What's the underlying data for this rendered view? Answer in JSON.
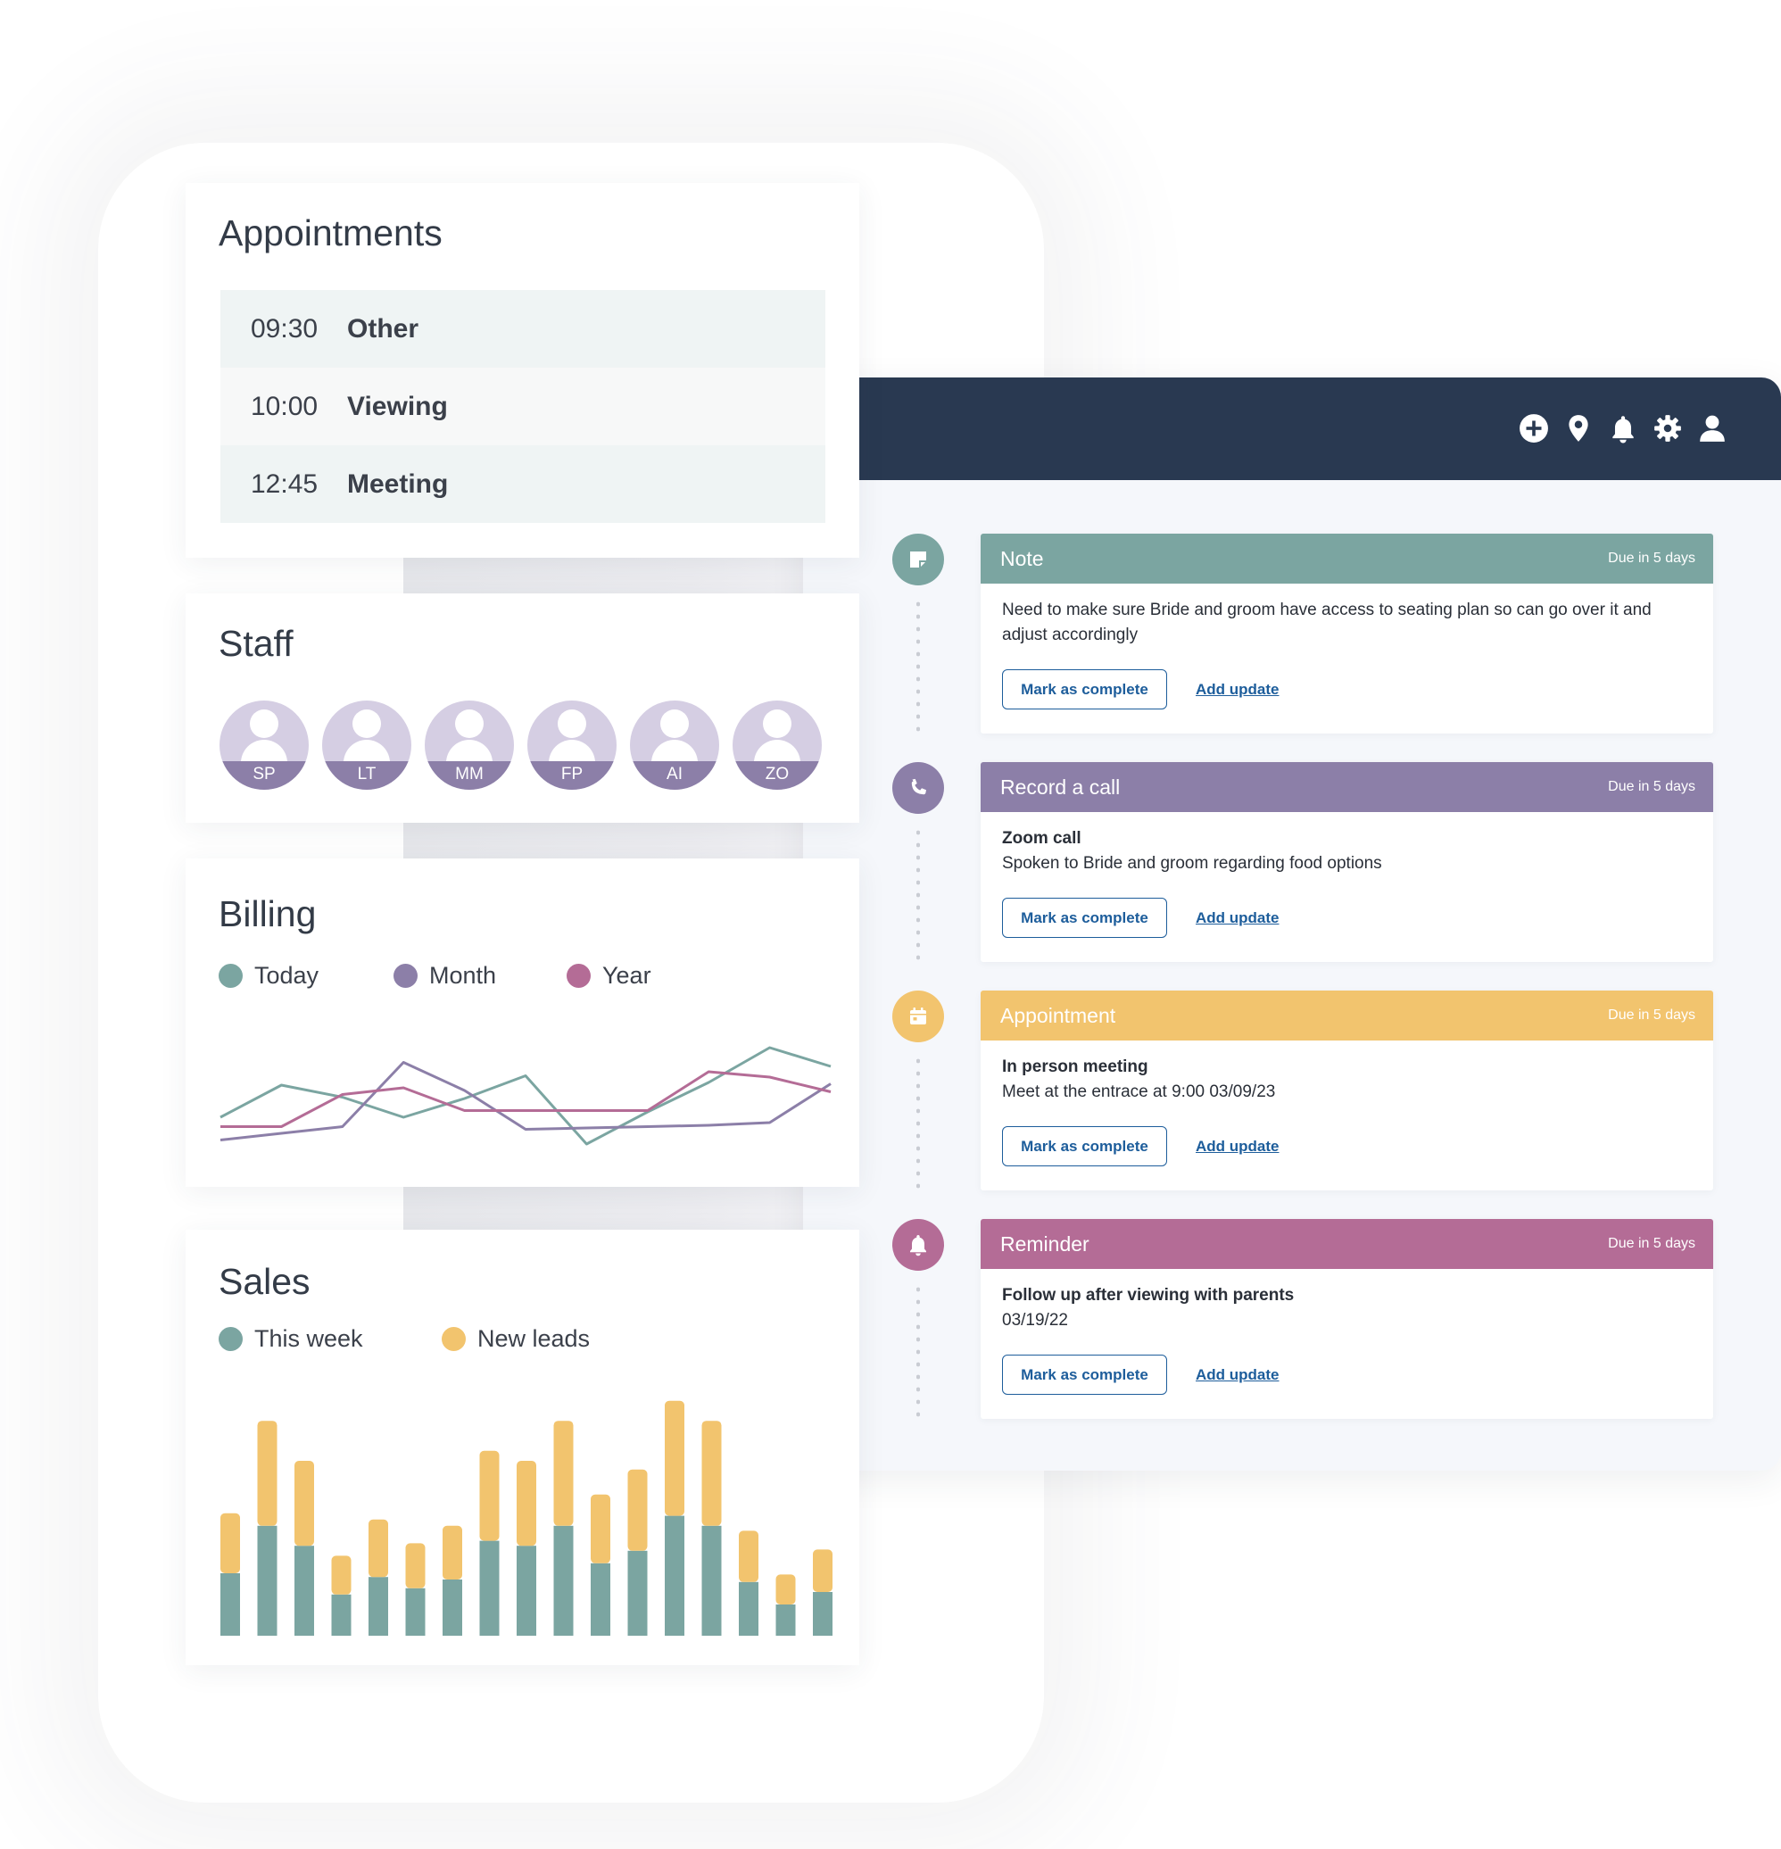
{
  "colors": {
    "teal": "#7ba5a1",
    "purple": "#8c7fa8",
    "yellow": "#f2c46e",
    "pink": "#b46c96",
    "navy": "#293951",
    "link_blue": "#1d5d9b"
  },
  "header": {
    "icons": [
      "add-circle-icon",
      "location-pin-icon",
      "bell-icon",
      "gear-icon",
      "user-icon"
    ]
  },
  "timeline": {
    "items": [
      {
        "type": "Note",
        "icon": "note-icon",
        "due": "Due in 5 days",
        "body_bold": "",
        "body": "Need to make sure Bride and groom have access to seating plan so can go over it and adjust accordingly",
        "complete_label": "Mark as complete",
        "update_label": "Add update"
      },
      {
        "type": "Record a call",
        "icon": "phone-icon",
        "due": "Due in 5 days",
        "body_bold": "Zoom call",
        "body": "Spoken to Bride and groom regarding food options",
        "complete_label": "Mark as complete",
        "update_label": "Add update"
      },
      {
        "type": "Appointment",
        "icon": "calendar-icon",
        "due": "Due in 5 days",
        "body_bold": "In person meeting",
        "body": "Meet at the entrace at 9:00 03/09/23",
        "complete_label": "Mark as complete",
        "update_label": "Add update"
      },
      {
        "type": "Reminder",
        "icon": "bell-icon",
        "due": "Due in 5 days",
        "body_bold": "Follow up after viewing with parents",
        "body": "03/19/22",
        "complete_label": "Mark as complete",
        "update_label": "Add update"
      }
    ]
  },
  "appointments": {
    "title": "Appointments",
    "rows": [
      {
        "time": "09:30",
        "kind": "Other"
      },
      {
        "time": "10:00",
        "kind": "Viewing"
      },
      {
        "time": "12:45",
        "kind": "Meeting"
      }
    ]
  },
  "staff": {
    "title": "Staff",
    "members": [
      "SP",
      "LT",
      "MM",
      "FP",
      "AI",
      "ZO"
    ]
  },
  "billing": {
    "title": "Billing",
    "legend": [
      "Today",
      "Month",
      "Year"
    ]
  },
  "sales": {
    "title": "Sales",
    "legend": [
      "This week",
      "New leads"
    ]
  },
  "chart_data": [
    {
      "type": "line",
      "title": "Billing",
      "x": [
        0,
        1,
        2,
        3,
        4,
        5,
        6,
        7,
        8,
        9,
        10
      ],
      "series": [
        {
          "name": "Today",
          "values": [
            2.0,
            4.4,
            3.5,
            2.0,
            3.4,
            5.1,
            0.0,
            2.4,
            4.6,
            7.2,
            5.8
          ]
        },
        {
          "name": "Month",
          "values": [
            0.3,
            0.8,
            1.3,
            6.1,
            4.0,
            1.1,
            1.2,
            1.3,
            1.4,
            1.6,
            4.5
          ]
        },
        {
          "name": "Year",
          "values": [
            1.3,
            1.3,
            3.7,
            4.2,
            2.5,
            2.5,
            2.5,
            2.5,
            5.4,
            5.0,
            3.9
          ]
        }
      ],
      "ylim": [
        0,
        8
      ],
      "grid": false,
      "legend": "top-left"
    },
    {
      "type": "bar",
      "title": "Sales",
      "stacked": true,
      "categories": [
        "1",
        "2",
        "3",
        "4",
        "5",
        "6",
        "7",
        "8",
        "9",
        "10",
        "11",
        "12",
        "13",
        "14",
        "15",
        "16",
        "17"
      ],
      "series": [
        {
          "name": "This week",
          "values": [
            50,
            88,
            72,
            33,
            47,
            38,
            45,
            76,
            72,
            88,
            58,
            68,
            96,
            88,
            43,
            25,
            35
          ]
        },
        {
          "name": "New leads",
          "values": [
            48,
            84,
            68,
            31,
            46,
            36,
            43,
            72,
            68,
            84,
            55,
            65,
            92,
            84,
            41,
            24,
            34
          ]
        }
      ],
      "ylim": [
        0,
        200
      ],
      "grid": false,
      "legend": "top-left"
    }
  ]
}
